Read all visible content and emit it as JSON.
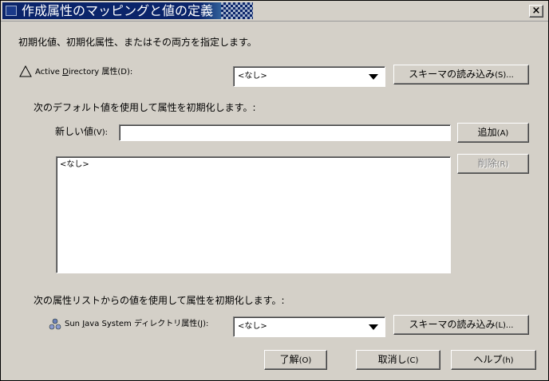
{
  "window": {
    "title": "作成属性のマッピングと値の定義",
    "close_glyph": "×"
  },
  "intro_text": "初期化値、初期化属性、またはその両方を指定します。",
  "ad_attribute": {
    "label_prefix": "Active ",
    "label_ul": "D",
    "label_mid": "irectory 属性",
    "label_mnemonic": "(D):",
    "combo_value": "<なし>",
    "load_schema_button": "スキーマの読み込み",
    "load_schema_mnemonic": "(S)...",
    "icon": "warning-triangle-icon"
  },
  "default_values": {
    "heading": "次のデフォルト値を使用して属性を初期化します。:",
    "new_value_label": "新しい値",
    "new_value_mnemonic": "(V):",
    "new_value_input": "",
    "add_button": "追加",
    "add_mnemonic": "(A)",
    "delete_button": "削除",
    "delete_mnemonic": "(R)",
    "list_items": [
      "<なし>"
    ]
  },
  "attribute_list": {
    "heading": "次の属性リストからの値を使用して属性を初期化します。:",
    "label_prefix": "Sun ",
    "label_ul": "J",
    "label_mid": "ava System ディレクトリ属性",
    "label_mnemonic": "(J):",
    "combo_value": "<なし>",
    "load_schema_button": "スキーマの読み込み",
    "load_schema_mnemonic": "(L)...",
    "icon": "directory-users-icon"
  },
  "footer": {
    "ok_button": "了解",
    "ok_mnemonic": "(O)",
    "cancel_button": "取消し",
    "cancel_mnemonic": "(C)",
    "help_button": "ヘルプ",
    "help_mnemonic": "(h)"
  }
}
